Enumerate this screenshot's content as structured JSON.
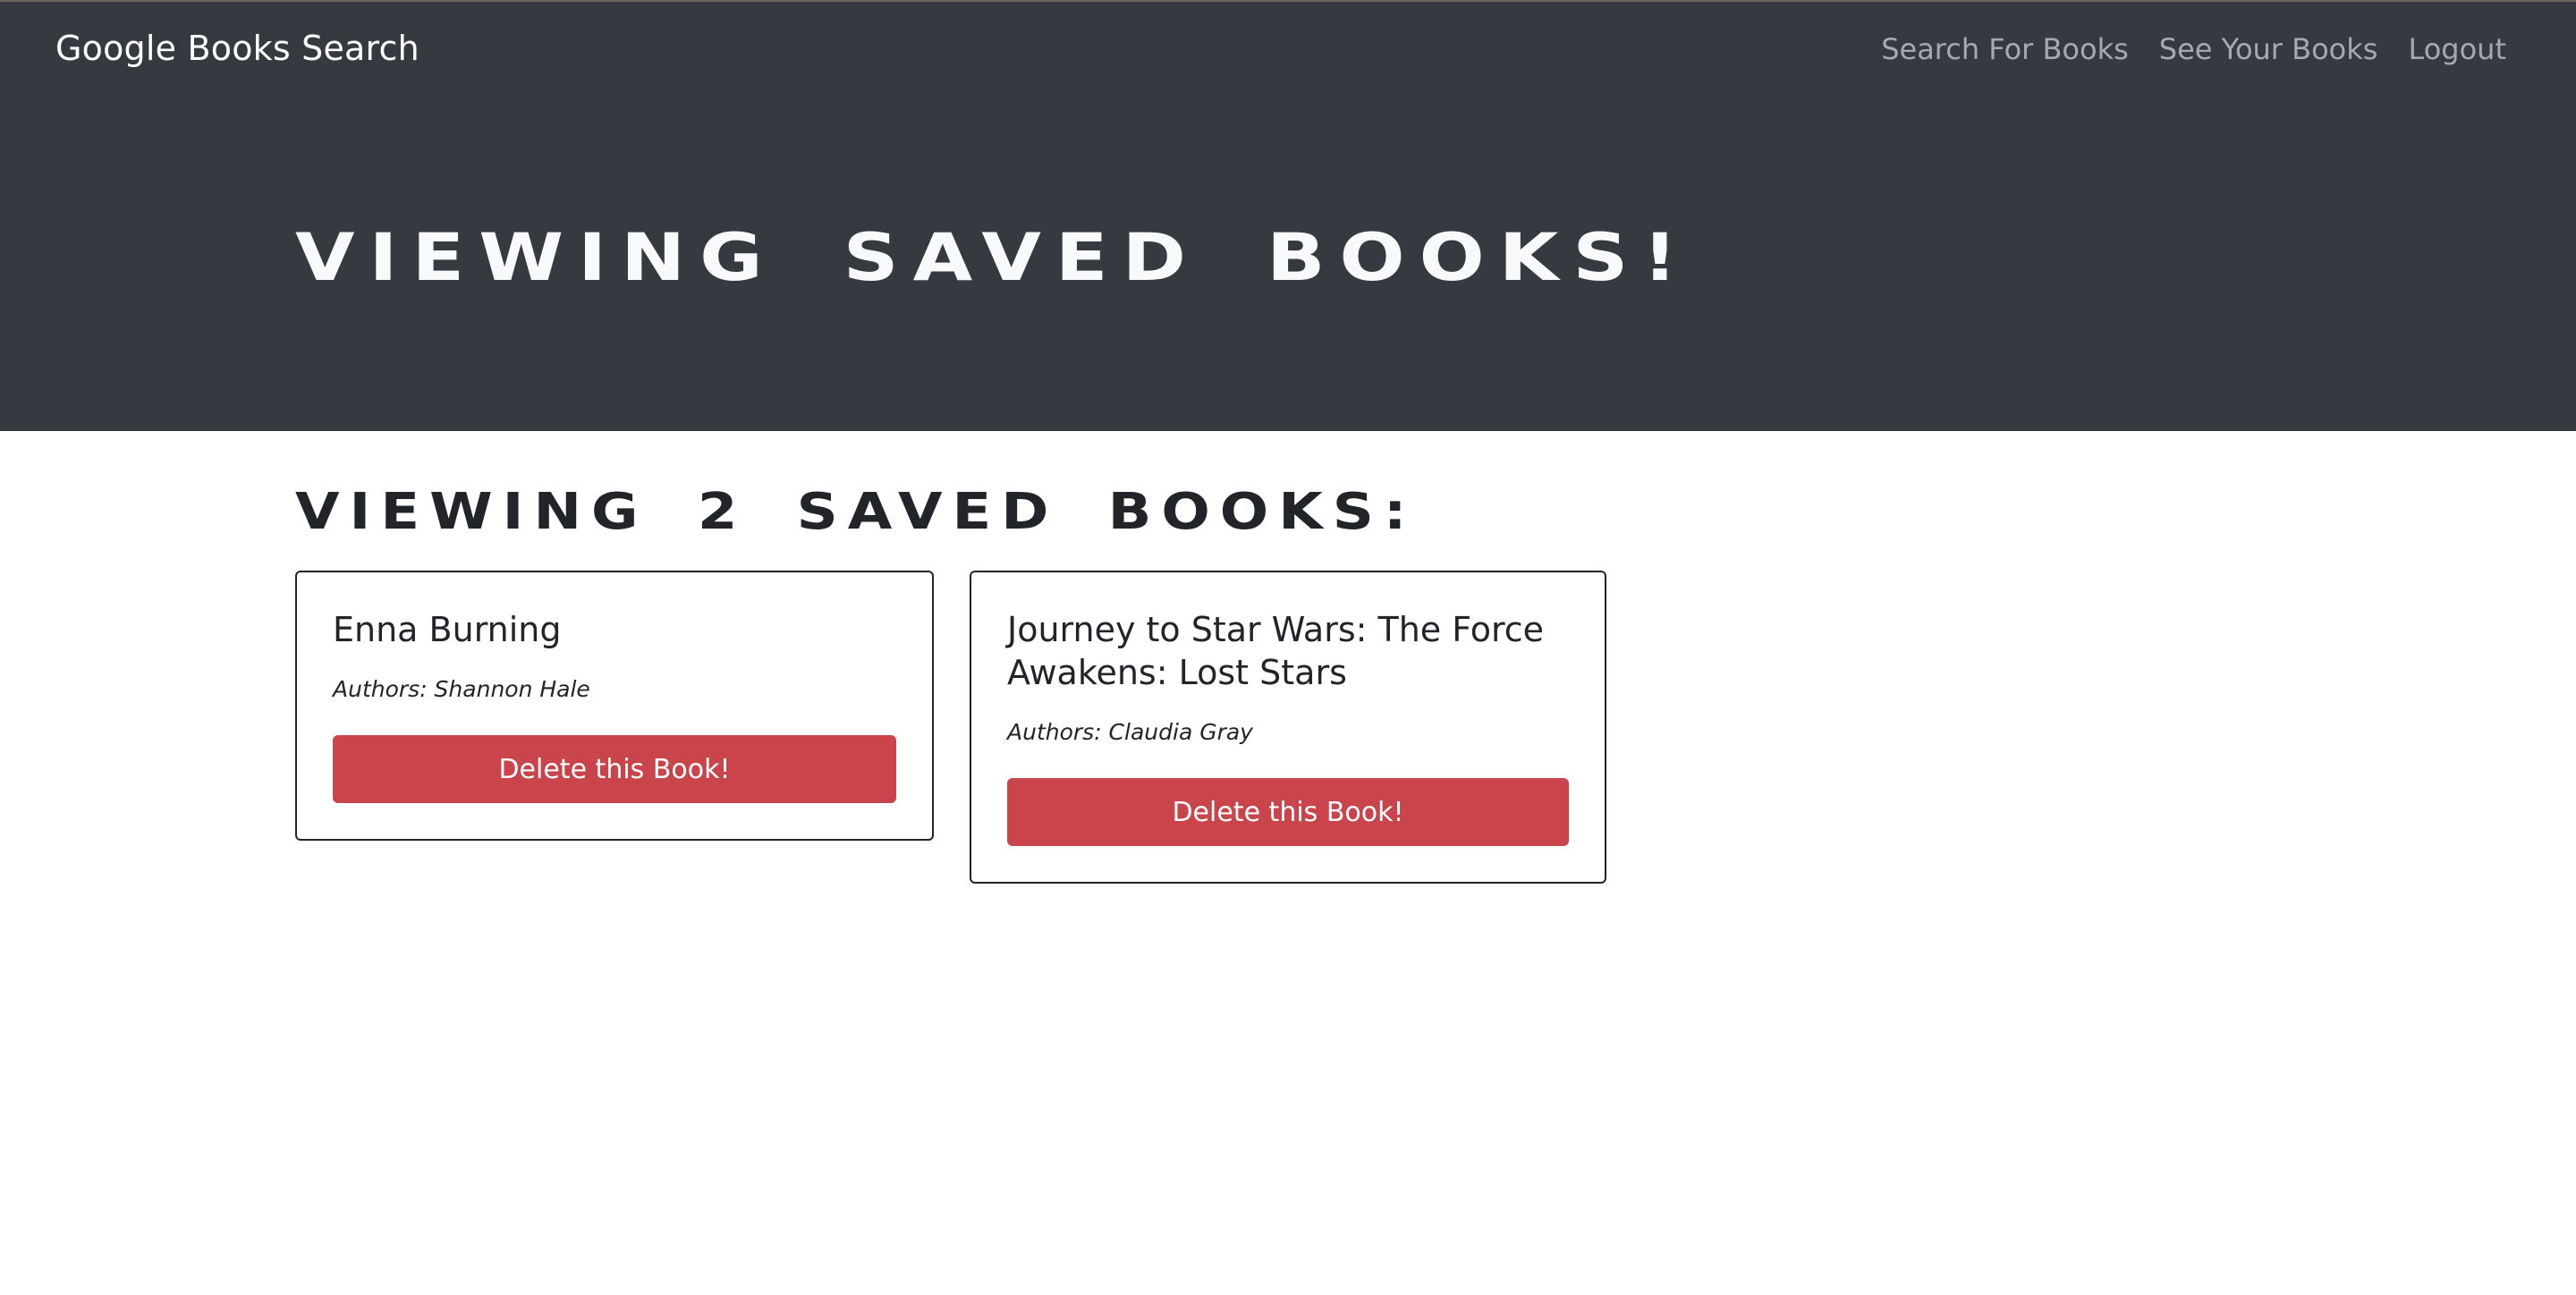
{
  "navbar": {
    "brand": "Google Books Search",
    "links": [
      "Search For Books",
      "See Your Books",
      "Logout"
    ]
  },
  "jumbotron": {
    "title": "Viewing saved books!"
  },
  "main": {
    "heading": "Viewing 2 saved books:",
    "books": [
      {
        "title": "Enna Burning",
        "authors": "Authors: Shannon Hale",
        "delete_label": "Delete this Book!"
      },
      {
        "title": "Journey to Star Wars: The Force Awakens: Lost Stars",
        "authors": "Authors: Claudia Gray",
        "delete_label": "Delete this Book!"
      }
    ]
  },
  "colors": {
    "dark_bg": "#343a40",
    "danger": "#c9444b",
    "text": "#212529"
  }
}
